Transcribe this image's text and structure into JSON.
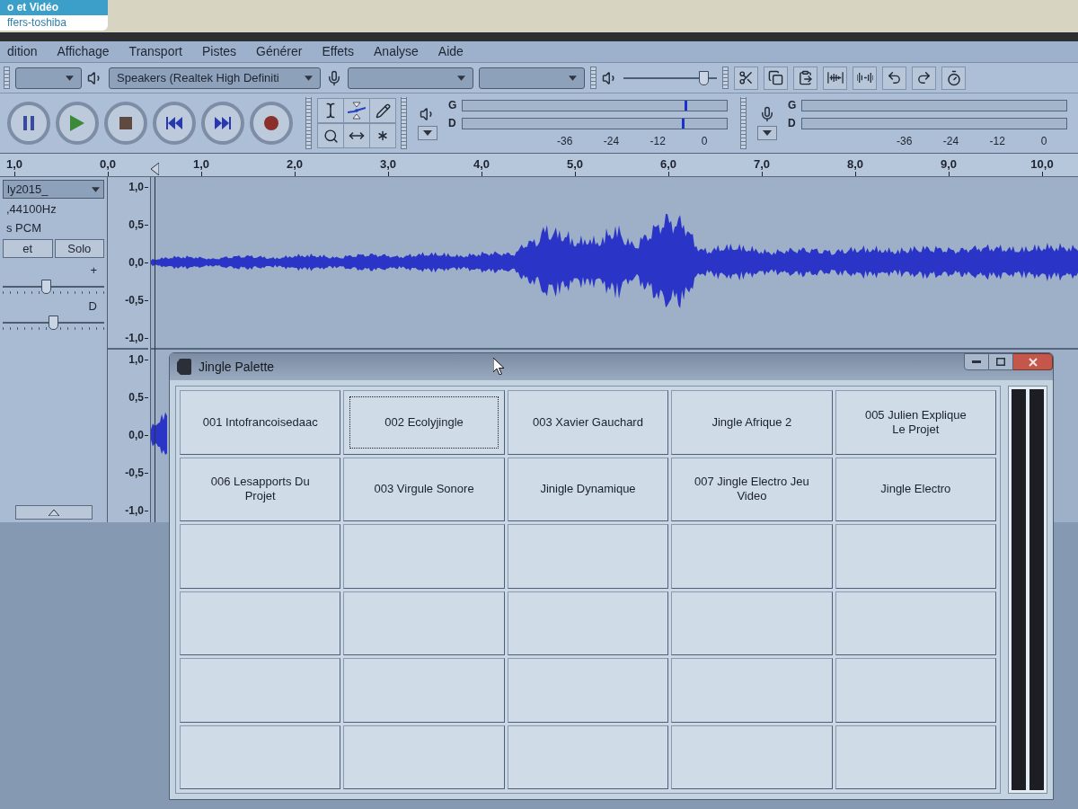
{
  "sticker": {
    "lines": [
      "o et Vidéo",
      "ffers-toshiba"
    ]
  },
  "menu_bar": {
    "items": [
      "dition",
      "Affichage",
      "Transport",
      "Pistes",
      "Générer",
      "Effets",
      "Analyse",
      "Aide"
    ]
  },
  "device_toolbar": {
    "output_device": "Speakers (Realtek High Definiti"
  },
  "mixer_toolbar": {
    "playback_volume": {
      "level": 0.9
    }
  },
  "meter_toolbar": {
    "meters": [
      {
        "kind": "playback",
        "channels": [
          {
            "label": "G",
            "level": 0.84
          },
          {
            "label": "D",
            "level": 0.83
          }
        ],
        "scale": [
          "-36",
          "-24",
          "-12",
          "0"
        ]
      },
      {
        "kind": "record",
        "channels": [
          {
            "label": "G"
          },
          {
            "label": "D"
          }
        ],
        "scale": [
          "-36",
          "-24",
          "-12",
          "0"
        ]
      }
    ]
  },
  "timeline": {
    "labels": [
      "1,0",
      "0,0",
      "1,0",
      "2,0",
      "3,0",
      "4,0",
      "5,0",
      "6,0",
      "7,0",
      "8,0",
      "9,0",
      "10,0"
    ]
  },
  "track": {
    "name": "ly2015_",
    "info": [
      ",44100Hz",
      "s PCM"
    ],
    "buttons": [
      {
        "label": "et",
        "on": false
      },
      {
        "label": "Solo",
        "on": false
      }
    ],
    "gain_slider": {
      "label": "+",
      "level": 0.42
    },
    "pan_slider": {
      "label": "D",
      "level": 0.5
    },
    "channels": [
      {
        "scale": [
          "1,0",
          "0,5",
          "0,0",
          "-0,5",
          "-1,0"
        ]
      },
      {
        "scale": [
          "1,0",
          "0,5",
          "0,0",
          "-0,5",
          "-1,0"
        ]
      }
    ]
  },
  "jingle_palette": {
    "title": "Jingle Palette",
    "buttons": [
      {
        "label": "001 Intofrancoisedaac",
        "selected": false
      },
      {
        "label": "002 Ecolyjingle",
        "selected": true
      },
      {
        "label": "003 Xavier Gauchard",
        "selected": false
      },
      {
        "label": "Jingle Afrique 2",
        "selected": false
      },
      {
        "label": "005 Julien Explique Le Projet",
        "selected": false
      },
      {
        "label": "006 Lesapports Du Projet",
        "selected": false
      },
      {
        "label": "003 Virgule Sonore",
        "selected": false
      },
      {
        "label": "Jinigle Dynamique",
        "selected": false
      },
      {
        "label": "007 Jingle Electro Jeu Video",
        "selected": false
      },
      {
        "label": "Jingle Electro",
        "selected": false
      },
      {
        "selected": false
      },
      {
        "selected": false
      },
      {
        "selected": false
      },
      {
        "selected": false
      },
      {
        "selected": false
      },
      {
        "selected": false
      },
      {
        "selected": false
      },
      {
        "selected": false
      },
      {
        "selected": false
      },
      {
        "selected": false
      },
      {
        "selected": false
      },
      {
        "selected": false
      },
      {
        "selected": false
      },
      {
        "selected": false
      },
      {
        "selected": false
      },
      {
        "selected": false
      },
      {
        "selected": false
      },
      {
        "selected": false
      },
      {
        "selected": false
      },
      {
        "selected": false
      }
    ]
  }
}
